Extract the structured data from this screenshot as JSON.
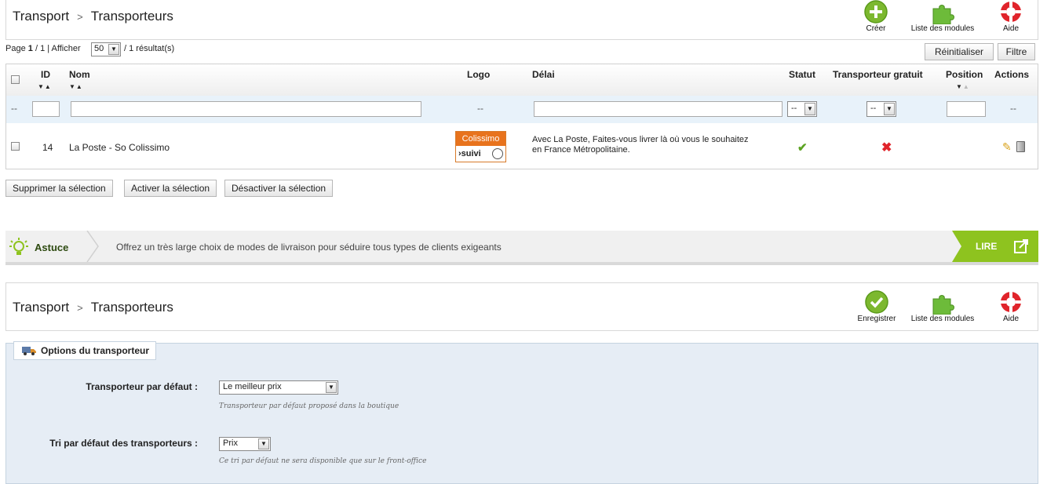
{
  "toolbar_top": {
    "breadcrumb": [
      "Transport",
      "Transporteurs"
    ],
    "separator": ">",
    "buttons": {
      "create": "Créer",
      "modules": "Liste des modules",
      "help": "Aide"
    }
  },
  "pagination": {
    "page_label": "Page",
    "page_current": "1",
    "page_rest": "/ 1 | Afficher",
    "per_page": "50",
    "results": "/ 1 résultat(s)"
  },
  "list_actions": {
    "reset": "Réinitialiser",
    "filter": "Filtre"
  },
  "table": {
    "headers": {
      "id": "ID",
      "nom": "Nom",
      "logo": "Logo",
      "delai": "Délai",
      "statut": "Statut",
      "gratuit": "Transporteur gratuit",
      "position": "Position",
      "actions": "Actions"
    },
    "filter_dash": "--",
    "rows": [
      {
        "id": "14",
        "nom": "La Poste - So Colissimo",
        "logo_top": "Colissimo",
        "logo_bottom": "›suivi",
        "delai_line1": "Avec La Poste, Faites-vous livrer là où vous le souhaitez",
        "delai_line2": "en France Métropolitaine.",
        "statut": "enabled",
        "gratuit": "disabled"
      }
    ]
  },
  "bulk_actions": {
    "delete": "Supprimer la sélection",
    "enable": "Activer la sélection",
    "disable": "Désactiver la sélection"
  },
  "tip": {
    "label": "Astuce",
    "text": "Offrez un très large choix de modes de livraison pour séduire tous types de clients exigeants",
    "read": "LIRE"
  },
  "toolbar_bottom": {
    "breadcrumb": [
      "Transport",
      "Transporteurs"
    ],
    "separator": ">",
    "buttons": {
      "save": "Enregistrer",
      "modules": "Liste des modules",
      "help": "Aide"
    }
  },
  "form": {
    "legend": "Options du transporteur",
    "fields": [
      {
        "label": "Transporteur par défaut :",
        "value": "Le meilleur prix",
        "hint": "Transporteur par défaut proposé dans la boutique"
      },
      {
        "label": "Tri par défaut des transporteurs :",
        "value": "Prix",
        "hint": "Ce tri par défaut ne sera disponible que sur le front-office"
      }
    ]
  },
  "colors": {
    "green": "#7cb82f",
    "red": "#e0242b",
    "orange": "#e8731d",
    "tip_green": "#8ec31f"
  }
}
